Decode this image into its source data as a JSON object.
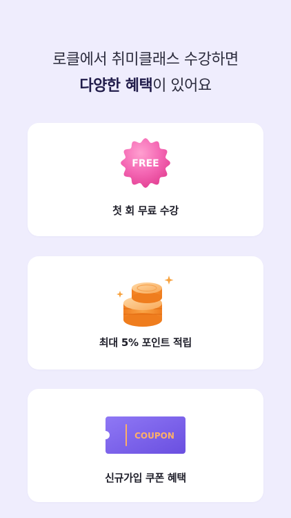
{
  "headline": {
    "line1": "로클에서 취미클래스 수강하면",
    "line2_bold": "다양한 혜택",
    "line2_rest": "이 있어요"
  },
  "benefits": [
    {
      "icon": "free-badge-icon",
      "badge_text": "FREE",
      "label": "첫 회 무료 수강"
    },
    {
      "icon": "coins-icon",
      "label": "최대 5% 포인트 적립"
    },
    {
      "icon": "coupon-icon",
      "badge_text": "COUPON",
      "label": "신규가입 쿠폰 혜택"
    }
  ],
  "colors": {
    "background": "#efedfd",
    "card": "#ffffff",
    "free_badge": "#f25aa8",
    "coin": "#f59a3c",
    "coupon": "#7b62ea",
    "coupon_text": "#ffb066"
  }
}
